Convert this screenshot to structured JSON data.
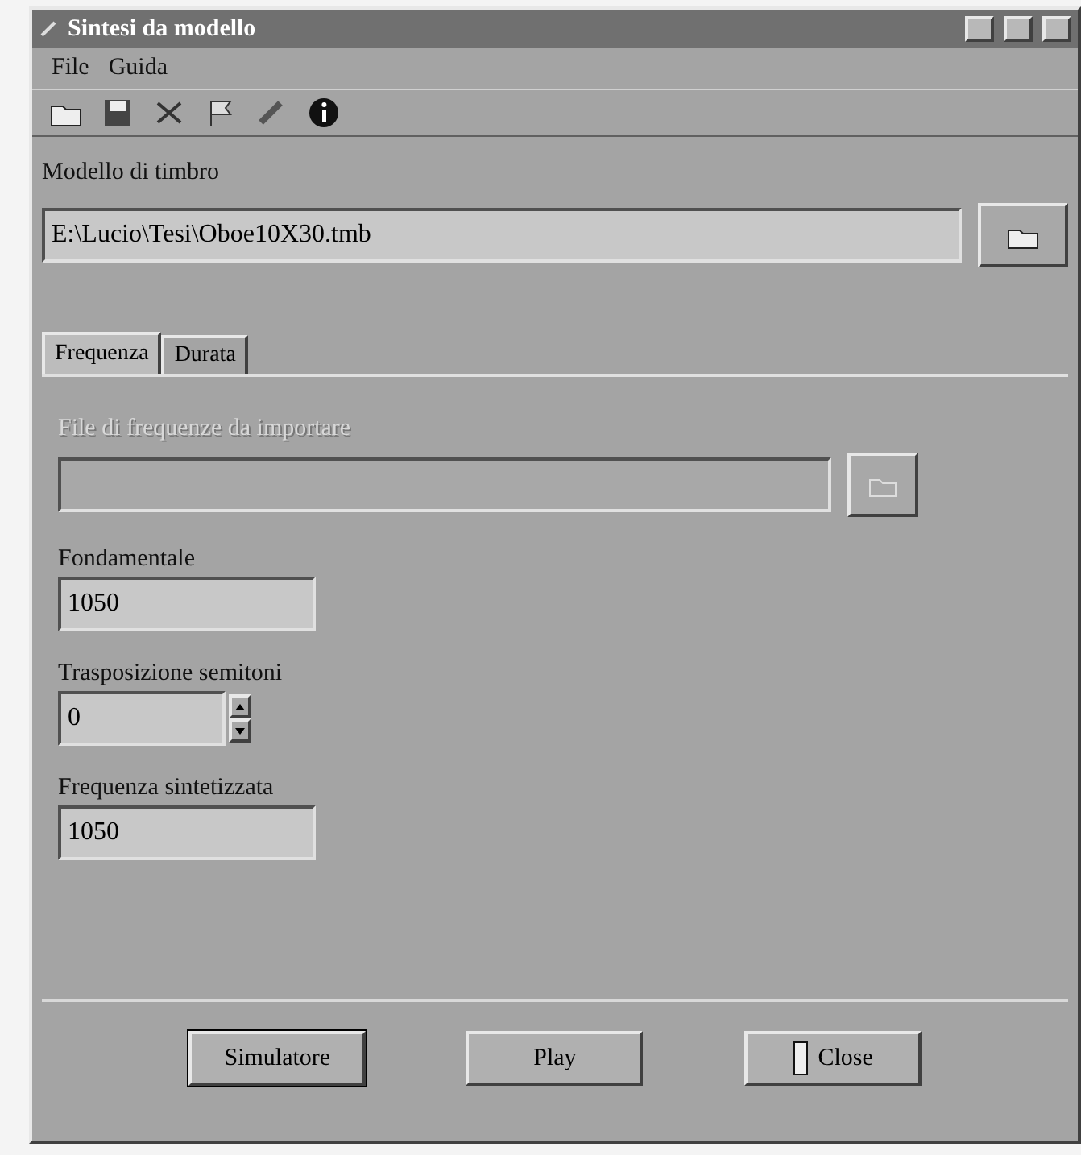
{
  "window": {
    "title": "Sintesi da modello"
  },
  "menu": [
    {
      "label": "File"
    },
    {
      "label": "Guida"
    }
  ],
  "model": {
    "label": "Modello di timbro",
    "value": "E:\\Lucio\\Tesi\\Oboe10X30.tmb"
  },
  "tabs": [
    {
      "label": "Frequenza",
      "selected": true
    },
    {
      "label": "Durata",
      "selected": false
    }
  ],
  "file_field": {
    "label": "File di frequenze da importare",
    "disabled": true
  },
  "fields": [
    {
      "label": "Fondamentale",
      "value": "1050",
      "kind": "text"
    },
    {
      "label": "Trasposizione semitoni",
      "value": "0",
      "kind": "spin"
    },
    {
      "label": "Frequenza sintetizzata",
      "value": "1050",
      "kind": "text"
    }
  ],
  "buttons": [
    {
      "label": "Simulatore",
      "kind": "plain",
      "default": true
    },
    {
      "label": "Play",
      "kind": "plain",
      "default": false
    },
    {
      "label": "Close",
      "kind": "door",
      "default": false
    }
  ]
}
